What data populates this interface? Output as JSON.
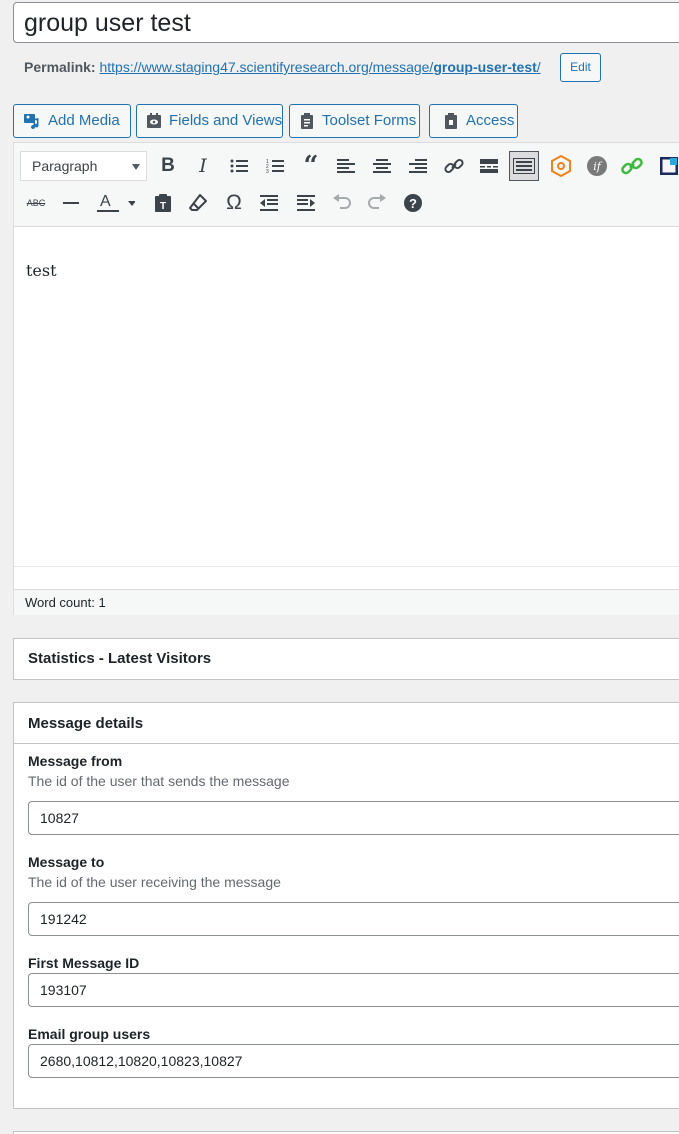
{
  "title": "group user test",
  "permalink": {
    "label": "Permalink:",
    "url_base": "https://www.staging47.scientifyresearch.org/message/",
    "slug": "group-user-test",
    "url_end": "/",
    "edit_label": "Edit"
  },
  "media_buttons": {
    "add_media": "Add Media",
    "fields_views": "Fields and Views",
    "toolset_forms": "Toolset Forms",
    "access": "Access"
  },
  "toolbar": {
    "format_value": "Paragraph",
    "icons_row1": [
      "bold-icon",
      "italic-icon",
      "bullet-list-icon",
      "numbered-list-icon",
      "blockquote-icon",
      "align-left-icon",
      "align-center-icon",
      "align-right-icon",
      "link-icon",
      "read-more-icon",
      "toolbar-toggle-icon",
      "toolset-icon",
      "conditional-icon",
      "green-link-icon",
      "toolset-forms-icon"
    ],
    "icons_row2": [
      "strikethrough-icon",
      "horizontal-line-icon",
      "text-color-icon",
      "paste-text-icon",
      "clear-formatting-icon",
      "special-char-icon",
      "outdent-icon",
      "indent-icon",
      "undo-icon",
      "redo-icon",
      "help-icon"
    ]
  },
  "editor": {
    "content": "test",
    "word_count": "Word count: 1"
  },
  "stats_box": {
    "title": "Statistics - Latest Visitors"
  },
  "message_details": {
    "title": "Message details",
    "fields": [
      {
        "label": "Message from",
        "description": "The id of the user that sends the message",
        "value": "10827"
      },
      {
        "label": "Message to",
        "description": "The id of the user receiving the message",
        "value": "191242"
      },
      {
        "label": "First Message ID",
        "value": "193107"
      },
      {
        "label": "Email group users",
        "value": "2680,10812,10820,10823,10827"
      }
    ]
  },
  "colors": {
    "accent": "#2271b1",
    "toolset_orange": "#f0821e",
    "link_green": "#3fb93f",
    "border": "#c3c4c7"
  }
}
